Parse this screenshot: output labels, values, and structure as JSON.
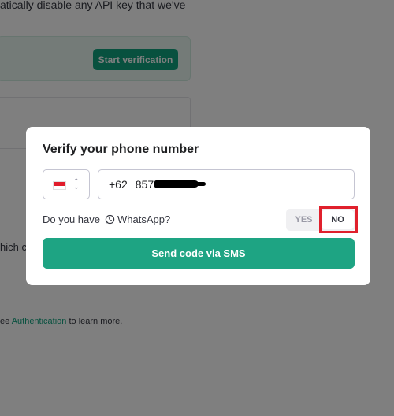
{
  "background": {
    "top_text": "atically disable any API key that we've",
    "start_verification_label": "Start verification",
    "which_text": "hich c",
    "see_prefix": "ee ",
    "auth_link": "Authentication",
    "see_suffix": " to learn more."
  },
  "modal": {
    "title": "Verify your phone number",
    "country": {
      "flag": "indonesia-flag",
      "selector_icon": "up-down-chevron-icon"
    },
    "phone": {
      "prefix": "+62",
      "value": "8570"
    },
    "whatsapp": {
      "question_prefix": "Do you have",
      "icon": "whatsapp-icon",
      "label": "WhatsApp?",
      "yes_label": "YES",
      "no_label": "NO",
      "selected": "NO"
    },
    "send_button_label": "Send code via SMS"
  },
  "colors": {
    "accent": "#10a37f",
    "highlight": "#e0202c"
  }
}
